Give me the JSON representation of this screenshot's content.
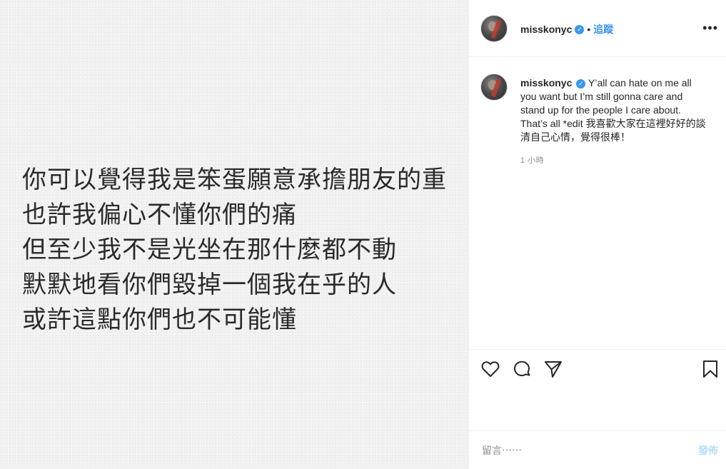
{
  "post": {
    "image_lines": [
      "你可以覺得我是笨蛋願意承擔朋友的重",
      "也許我偏心不懂你們的痛",
      "但至少我不是光坐在那什麼都不動",
      "默默地看你們毀掉一個我在乎的人",
      "或許這點你們也不可能懂"
    ]
  },
  "header": {
    "username": "misskonyc",
    "verified_icon": "verified-badge-icon",
    "separator": "•",
    "follow_label": "追蹤",
    "more_label": "•••"
  },
  "caption": {
    "username": "misskonyc",
    "text": "Y’all can hate on me all you want but I’m still gonna care and stand up for the people I care about. That’s all *edit 我喜歡大家在這裡好好的談清自己心情，覺得很棒！",
    "time": "1 小時"
  },
  "actions": {
    "icons": [
      "heart-icon",
      "comment-icon",
      "share-icon",
      "bookmark-icon"
    ]
  },
  "comment": {
    "placeholder": "留言⋯⋯",
    "post_label": "發佈"
  },
  "colors": {
    "accent": "#3897f0",
    "post_disabled": "#b2dffc",
    "text": "#262626",
    "muted": "#8e8e8e",
    "image_bg": "#f2f2f2"
  }
}
